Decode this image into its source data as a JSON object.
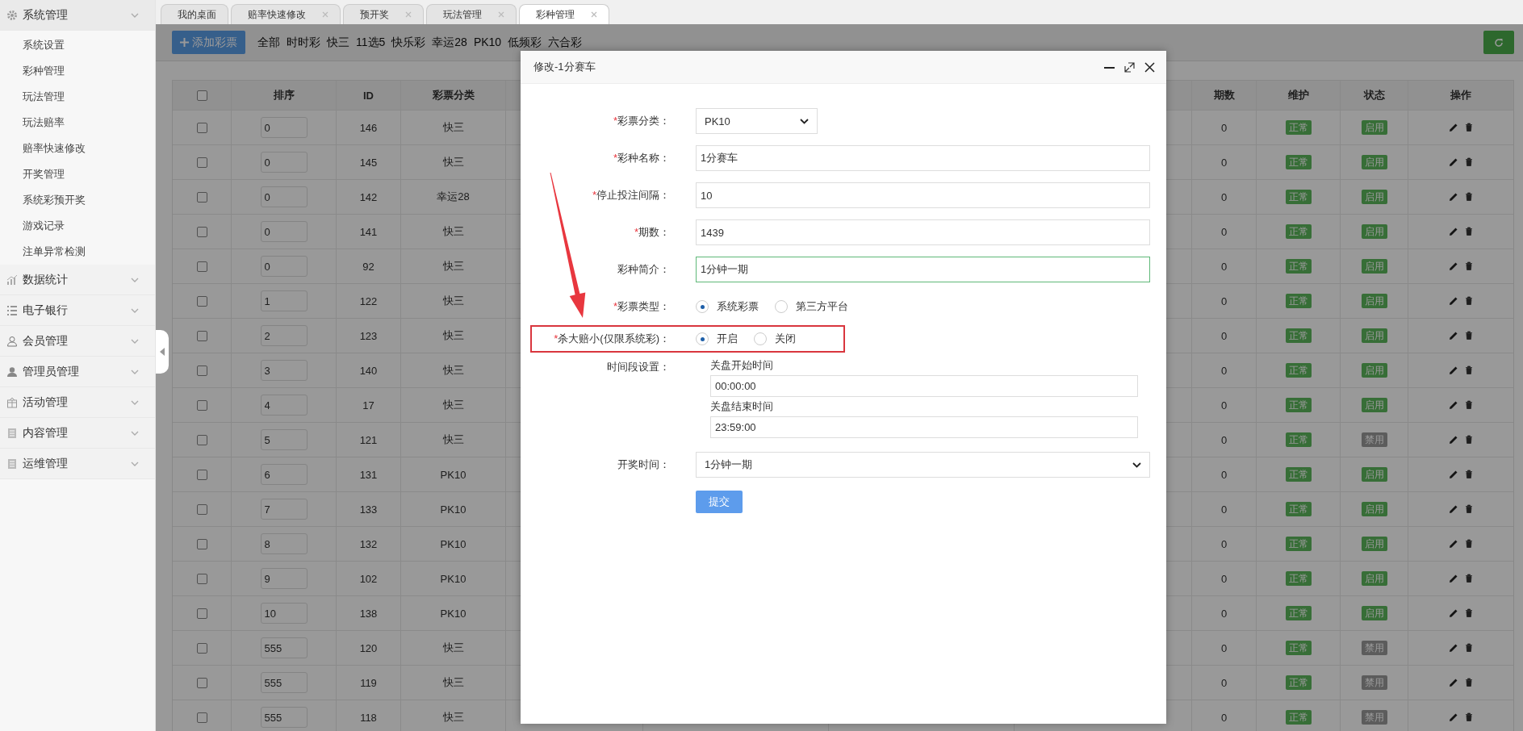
{
  "tabs": [
    {
      "label": "我的桌面",
      "closable": false,
      "selected": false
    },
    {
      "label": "赔率快速修改",
      "closable": true,
      "selected": false
    },
    {
      "label": "预开奖",
      "closable": true,
      "selected": false
    },
    {
      "label": "玩法管理",
      "closable": true,
      "selected": false
    },
    {
      "label": "彩种管理",
      "closable": true,
      "selected": true
    }
  ],
  "sidebar": {
    "groups": [
      {
        "label": "系统管理",
        "items": [
          {
            "label": "系统设置",
            "selected": false
          },
          {
            "label": "彩种管理",
            "selected": false
          },
          {
            "label": "玩法管理",
            "selected": false
          },
          {
            "label": "玩法赔率",
            "selected": false
          },
          {
            "label": "赔率快速修改",
            "selected": false
          },
          {
            "label": "开奖管理",
            "selected": false
          },
          {
            "label": "系统彩预开奖",
            "selected": false
          },
          {
            "label": "游戏记录",
            "selected": false
          },
          {
            "label": "注单异常检测",
            "selected": false
          }
        ]
      },
      {
        "label": "数据统计"
      },
      {
        "label": "电子银行"
      },
      {
        "label": "会员管理"
      },
      {
        "label": "管理员管理"
      },
      {
        "label": "活动管理"
      },
      {
        "label": "内容管理"
      },
      {
        "label": "运维管理"
      }
    ]
  },
  "toolbar": {
    "add_button": "添加彩票",
    "filters": [
      "全部",
      "时时彩",
      "快三",
      "11选5",
      "快乐彩",
      "幸运28",
      "PK10",
      "低频彩",
      "六合彩"
    ]
  },
  "table": {
    "all_checked": false,
    "columns": [
      "排序",
      "ID",
      "彩票分类",
      "期数",
      "维护",
      "状态",
      "操作"
    ],
    "rows": [
      {
        "checked": false,
        "order": "0",
        "id": "146",
        "category": "快三",
        "periods": "0",
        "maintenance": "正常",
        "status": {
          "label": "启用",
          "enabled": true
        }
      },
      {
        "checked": false,
        "order": "0",
        "id": "145",
        "category": "快三",
        "periods": "0",
        "maintenance": "正常",
        "status": {
          "label": "启用",
          "enabled": true
        }
      },
      {
        "checked": false,
        "order": "0",
        "id": "142",
        "category": "幸运28",
        "periods": "0",
        "maintenance": "正常",
        "status": {
          "label": "启用",
          "enabled": true
        }
      },
      {
        "checked": false,
        "order": "0",
        "id": "141",
        "category": "快三",
        "periods": "0",
        "maintenance": "正常",
        "status": {
          "label": "启用",
          "enabled": true
        }
      },
      {
        "checked": false,
        "order": "0",
        "id": "92",
        "category": "快三",
        "periods": "0",
        "maintenance": "正常",
        "status": {
          "label": "启用",
          "enabled": true
        }
      },
      {
        "checked": false,
        "order": "1",
        "id": "122",
        "category": "快三",
        "periods": "0",
        "maintenance": "正常",
        "status": {
          "label": "启用",
          "enabled": true
        }
      },
      {
        "checked": false,
        "order": "2",
        "id": "123",
        "category": "快三",
        "periods": "0",
        "maintenance": "正常",
        "status": {
          "label": "启用",
          "enabled": true
        }
      },
      {
        "checked": false,
        "order": "3",
        "id": "140",
        "category": "快三",
        "periods": "0",
        "maintenance": "正常",
        "status": {
          "label": "启用",
          "enabled": true
        }
      },
      {
        "checked": false,
        "order": "4",
        "id": "17",
        "category": "快三",
        "periods": "0",
        "maintenance": "正常",
        "status": {
          "label": "启用",
          "enabled": true
        }
      },
      {
        "checked": false,
        "order": "5",
        "id": "121",
        "category": "快三",
        "periods": "0",
        "maintenance": "正常",
        "status": {
          "label": "禁用",
          "enabled": false
        }
      },
      {
        "checked": false,
        "order": "6",
        "id": "131",
        "category": "PK10",
        "periods": "0",
        "maintenance": "正常",
        "status": {
          "label": "启用",
          "enabled": true
        }
      },
      {
        "checked": false,
        "order": "7",
        "id": "133",
        "category": "PK10",
        "periods": "0",
        "maintenance": "正常",
        "status": {
          "label": "启用",
          "enabled": true
        }
      },
      {
        "checked": false,
        "order": "8",
        "id": "132",
        "category": "PK10",
        "periods": "0",
        "maintenance": "正常",
        "status": {
          "label": "启用",
          "enabled": true
        }
      },
      {
        "checked": false,
        "order": "9",
        "id": "102",
        "category": "PK10",
        "periods": "0",
        "maintenance": "正常",
        "status": {
          "label": "启用",
          "enabled": true
        }
      },
      {
        "checked": false,
        "order": "10",
        "id": "138",
        "category": "PK10",
        "periods": "0",
        "maintenance": "正常",
        "status": {
          "label": "启用",
          "enabled": true
        }
      },
      {
        "checked": false,
        "order": "555",
        "id": "120",
        "category": "快三",
        "periods": "0",
        "maintenance": "正常",
        "status": {
          "label": "禁用",
          "enabled": false
        }
      },
      {
        "checked": false,
        "order": "555",
        "id": "119",
        "category": "快三",
        "periods": "0",
        "maintenance": "正常",
        "status": {
          "label": "禁用",
          "enabled": false
        }
      },
      {
        "checked": false,
        "order": "555",
        "id": "118",
        "category": "快三",
        "periods": "0",
        "maintenance": "正常",
        "status": {
          "label": "禁用",
          "enabled": false
        }
      }
    ]
  },
  "modal": {
    "title": "修改-1分赛车",
    "fields": [
      {
        "kind": "select",
        "label": "彩票分类：",
        "required_mark": "*",
        "value": "PK10"
      },
      {
        "kind": "text",
        "label": "彩种名称：",
        "required_mark": "*",
        "value": "1分赛车",
        "focused": false
      },
      {
        "kind": "text",
        "label": "停止投注间隔：",
        "required_mark": "*",
        "value": "10",
        "focused": false
      },
      {
        "kind": "text",
        "label": "期数：",
        "required_mark": "*",
        "value": "1439",
        "focused": false
      },
      {
        "kind": "text",
        "label": "彩种简介：",
        "value": "1分钟一期",
        "focused": true
      },
      {
        "kind": "radio",
        "label": "彩票类型：",
        "required_mark": "*",
        "options": [
          {
            "label": "系统彩票",
            "selected": true
          },
          {
            "label": "第三方平台",
            "selected": false
          }
        ]
      },
      {
        "kind": "radio",
        "label": "杀大赔小(仅限系统彩)：",
        "required_mark": "*",
        "highlighted": true,
        "options": [
          {
            "label": "开启",
            "selected": true
          },
          {
            "label": "关闭",
            "selected": false
          }
        ]
      },
      {
        "kind": "timerange",
        "label": "时间段设置：",
        "parts": [
          {
            "caption": "关盘开始时间",
            "value": "00:00:00"
          },
          {
            "caption": "关盘结束时间",
            "value": "23:59:00"
          }
        ]
      },
      {
        "kind": "wideselect",
        "label": "开奖时间：",
        "value": "1分钟一期"
      }
    ],
    "submit": "提交"
  }
}
